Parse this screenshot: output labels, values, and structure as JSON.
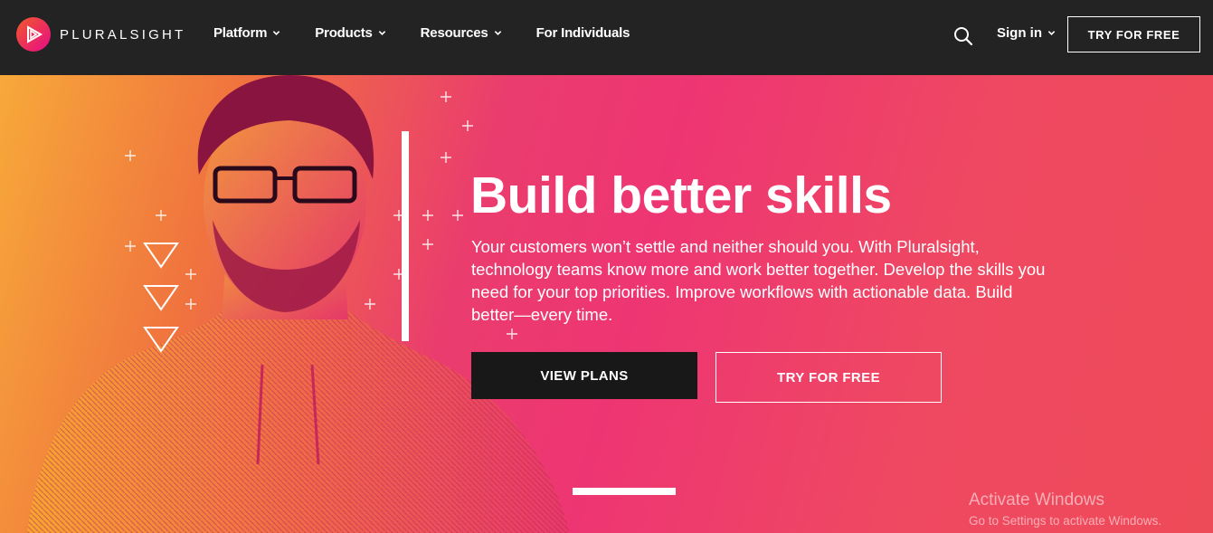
{
  "brand": {
    "name": "PLURALSIGHT",
    "logo_icon": "play-triangle-logo-icon",
    "colors": {
      "accent": "#e80a89",
      "orange": "#f05a28"
    }
  },
  "nav": {
    "items": [
      {
        "label": "Platform",
        "has_dropdown": true
      },
      {
        "label": "Products",
        "has_dropdown": true
      },
      {
        "label": "Resources",
        "has_dropdown": true
      },
      {
        "label": "For Individuals",
        "has_dropdown": false
      }
    ],
    "search_icon": "search-icon",
    "signin_label": "Sign in",
    "cta_label": "TRY FOR FREE"
  },
  "hero": {
    "headline": "Build better skills",
    "subtext": "Your customers won’t settle and neither should you. With Pluralsight, technology teams know more and work better together. Develop the skills you need for your top priorities. Improve workflows with actionable data. Build better—every time.",
    "primary_button": "VIEW PLANS",
    "secondary_button": "TRY FOR FREE"
  },
  "watermark": {
    "title": "Activate Windows",
    "subtitle": "Go to Settings to activate Windows."
  }
}
